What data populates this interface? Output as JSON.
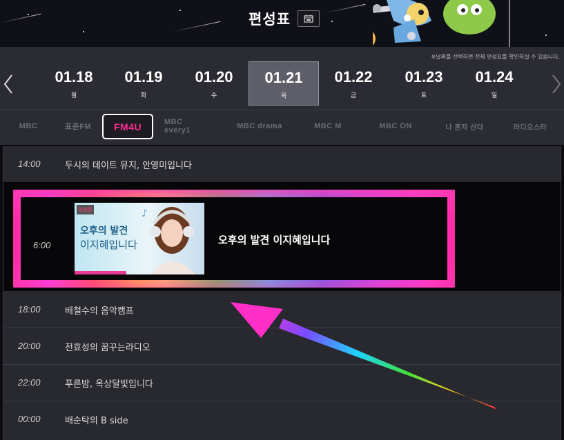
{
  "header": {
    "title": "편성표",
    "calendar_icon": "calendar-icon"
  },
  "notice": "※날짜를 선택하면 전체 편성표를 확인하실 수 있습니다.",
  "dates": [
    {
      "date": "01.18",
      "day": "월",
      "active": false
    },
    {
      "date": "01.19",
      "day": "화",
      "active": false
    },
    {
      "date": "01.20",
      "day": "수",
      "active": false
    },
    {
      "date": "01.21",
      "day": "목",
      "active": true
    },
    {
      "date": "01.22",
      "day": "금",
      "active": false
    },
    {
      "date": "01.23",
      "day": "토",
      "active": false
    },
    {
      "date": "01.24",
      "day": "일",
      "active": false
    }
  ],
  "channels": [
    {
      "label": "MBC",
      "active": false
    },
    {
      "label": "표준FM",
      "active": false
    },
    {
      "label": "FM4U",
      "active": true
    },
    {
      "label": "MBC every1",
      "active": false
    },
    {
      "label": "MBC drama",
      "active": false
    },
    {
      "label": "MBC M",
      "active": false
    },
    {
      "label": "MBC ON",
      "active": false
    },
    {
      "label": "나 혼자 산다",
      "active": false
    },
    {
      "label": "라디오스타",
      "active": false
    }
  ],
  "schedule": {
    "before": [
      {
        "time": "14:00",
        "program": "두시의 데이트 뮤지, 안영미입니다"
      }
    ],
    "featured": {
      "time": "6:00",
      "program": "오후의 발견 이지혜입니다",
      "thumb_badge": "방송중",
      "thumb_line1": "오후의 발견",
      "thumb_line2": "이지혜입니다"
    },
    "after": [
      {
        "time": "18:00",
        "program": "배철수의 음악캠프"
      },
      {
        "time": "20:00",
        "program": "전효성의 꿈꾸는라디오"
      },
      {
        "time": "22:00",
        "program": "푸른밤, 옥상달빛입니다"
      },
      {
        "time": "00:00",
        "program": "배순탁의 B side"
      }
    ]
  },
  "colors": {
    "active_channel": "#ff2d94",
    "background": "#0b0b10"
  }
}
